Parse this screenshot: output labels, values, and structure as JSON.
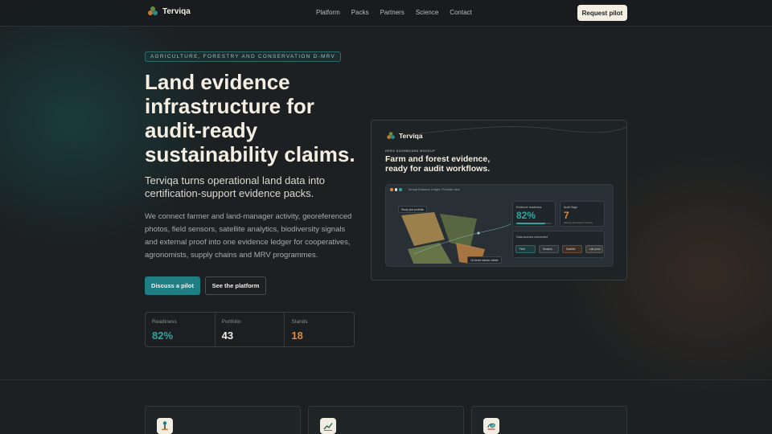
{
  "brand": {
    "name": "Terviqa"
  },
  "nav": {
    "links": [
      "Platform",
      "Packs",
      "Partners",
      "Science",
      "Contact"
    ],
    "cta": "Request pilot"
  },
  "hero": {
    "badge": "AGRICULTURE, FORESTRY AND CONSERVATION D-MRV",
    "title": "Land evidence infrastructure for audit-ready sustainability claims.",
    "subtitle": "Terviqa turns operational land data into certification-support evidence packs.",
    "body": "We connect farmer and land-manager activity, georeferenced photos, field sensors, satellite analytics, biodiversity signals and external proof into one evidence ledger for cooperatives, agronomists, supply chains and MRV programmes.",
    "primary_cta": "Discuss a pilot",
    "secondary_cta": "See the platform"
  },
  "stats": [
    {
      "label": "Readiness",
      "value": "82%",
      "color": "#2fa3a3"
    },
    {
      "label": "Portfolio",
      "value": "43",
      "color": "#f1eee6"
    },
    {
      "label": "Stands",
      "value": "18",
      "color": "#d98a3c"
    }
  ],
  "mockup": {
    "brand": "Terviqa",
    "kicker": "HERO DASHBOARD MOCKUP",
    "headline": "Farm and forest evidence, ready for audit workflows.",
    "window_title": "Terviqa Evidence Ledger / Portfolio view",
    "map_tag_1": "Study plot portfolio",
    "map_tag_2": "18 forest stands visible",
    "tile_readiness": {
      "label": "Evidence readiness",
      "value": "82%"
    },
    "tile_flags": {
      "label": "Audit flags",
      "value": "7",
      "note": "following processed 4 mid-daily"
    },
    "sources": {
      "label": "Data sources connected",
      "chips": [
        "Field",
        "Sensors",
        "Satellite",
        "Lab proof"
      ]
    }
  },
  "colors": {
    "accent": "#1f7e84",
    "orange": "#d98a3c",
    "teal": "#2fa3a3"
  }
}
